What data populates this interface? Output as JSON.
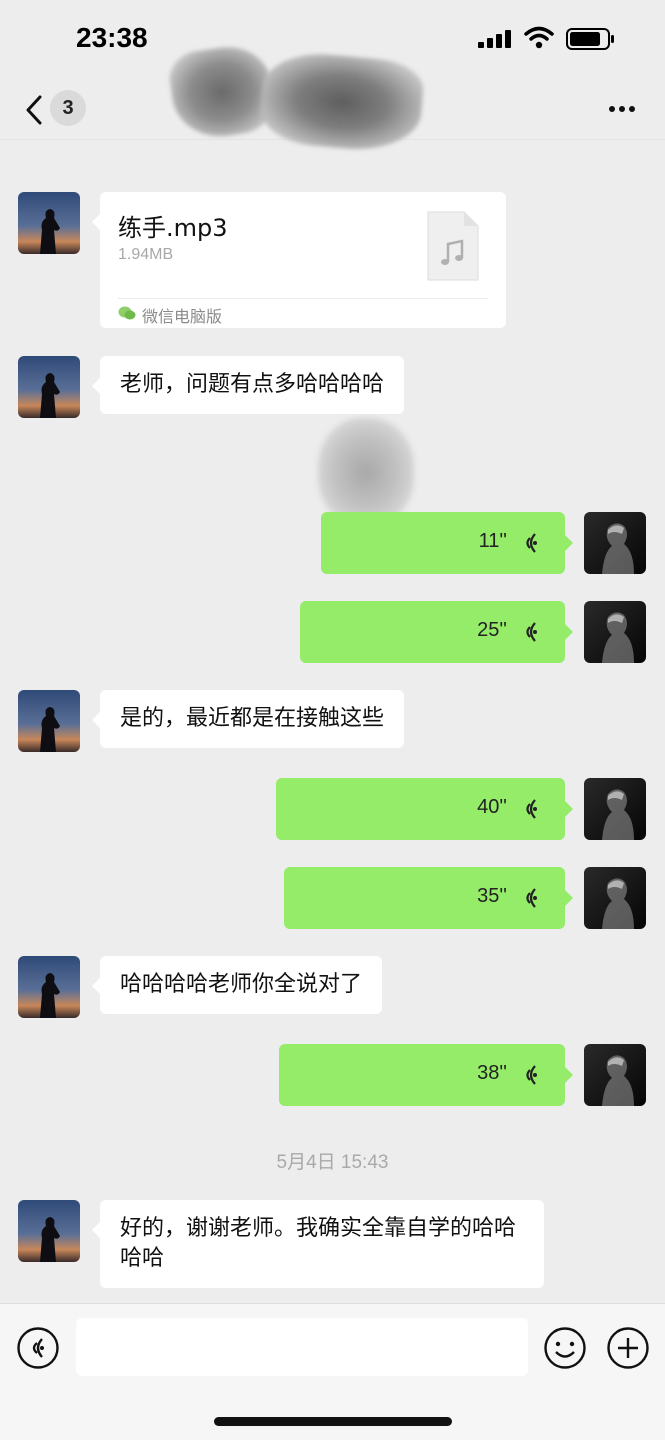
{
  "status_bar": {
    "time": "23:38"
  },
  "header": {
    "unread_count": "3",
    "title": ""
  },
  "messages": [
    {
      "side": "left",
      "type": "file",
      "file_name": "练手.mp3",
      "file_size": "1.94MB",
      "source": "微信电脑版"
    },
    {
      "side": "left",
      "type": "text",
      "text": "老师，问题有点多哈哈哈哈"
    },
    {
      "side": "right",
      "type": "voice",
      "duration": "11''"
    },
    {
      "side": "right",
      "type": "voice",
      "duration": "25''"
    },
    {
      "side": "left",
      "type": "text",
      "text": "是的，最近都是在接触这些"
    },
    {
      "side": "right",
      "type": "voice",
      "duration": "40''"
    },
    {
      "side": "right",
      "type": "voice",
      "duration": "35''"
    },
    {
      "side": "left",
      "type": "text",
      "text": "哈哈哈哈老师你全说对了"
    },
    {
      "side": "right",
      "type": "voice",
      "duration": "38''"
    },
    {
      "type": "timestamp",
      "text": "5月4日 15:43"
    },
    {
      "side": "left",
      "type": "text",
      "text": "好的，谢谢老师。我确实全靠自学的哈哈哈哈"
    }
  ],
  "input": {
    "value": "",
    "placeholder": ""
  },
  "colors": {
    "background": "#ededed",
    "my_bubble": "#95ec69",
    "their_bubble": "#ffffff"
  },
  "icons": [
    "signal-icon",
    "wifi-icon",
    "battery-icon",
    "back-icon",
    "more-icon",
    "music-file-icon",
    "wechat-icon",
    "voice-wave-icon",
    "voice-toggle-icon",
    "emoji-icon",
    "plus-icon"
  ]
}
